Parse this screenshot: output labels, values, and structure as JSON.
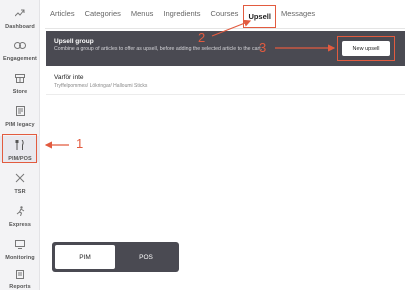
{
  "sidebar": {
    "items": [
      {
        "label": "Dashboard",
        "icon": "trend-icon"
      },
      {
        "label": "Engagement",
        "icon": "link-icon"
      },
      {
        "label": "Store",
        "icon": "store-icon"
      },
      {
        "label": "PIM legacy",
        "icon": "book-icon"
      },
      {
        "label": "PIM/POS",
        "icon": "fork-knife-icon"
      },
      {
        "label": "TSR",
        "icon": "cutlery-cross-icon"
      },
      {
        "label": "Express",
        "icon": "running-icon"
      },
      {
        "label": "Monitoring",
        "icon": "monitor-icon"
      },
      {
        "label": "Reports",
        "icon": "report-icon"
      }
    ],
    "active_index": 4
  },
  "tabs": [
    "Articles",
    "Categories",
    "Menus",
    "Ingredients",
    "Courses",
    "Upsell",
    "Messages"
  ],
  "active_tab": "Upsell",
  "banner": {
    "title": "Upsell group",
    "description": "Combine a group of articles to offer as upsell, before adding the selected article to the cart.",
    "button_label": "New upsell"
  },
  "groups": [
    {
      "name": "Varför inte",
      "items": "Tryffelpommes/ Lökringar/ Halloumi Sticks"
    }
  ],
  "toggle": {
    "options": [
      "PIM",
      "POS"
    ],
    "selected": "PIM"
  },
  "annotations": [
    "1",
    "2",
    "3"
  ],
  "colors": {
    "annotation": "#e25b3f",
    "banner": "#4a4a52",
    "sidebar": "#f3f3f5"
  }
}
